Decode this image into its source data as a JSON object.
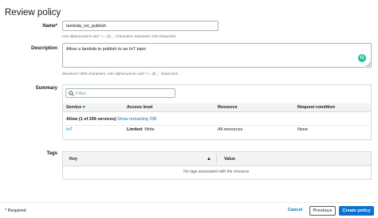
{
  "page": {
    "title": "Review policy"
  },
  "form": {
    "name": {
      "label": "Name*",
      "value": "lambda_iot_publish",
      "hint": "Use alphanumeric and '+=,.@-_' characters. Maximum 128 characters."
    },
    "description": {
      "label": "Description",
      "value": "Allow a lambda to publish to an IoT topic",
      "hint": "Maximum 1000 characters. Use alphanumeric and '+=,.@-_' characters.",
      "grammarly_icon": "G"
    }
  },
  "summary": {
    "label": "Summary",
    "filter_placeholder": "Filter",
    "columns": {
      "service": "Service",
      "access": "Access level",
      "resource": "Resource",
      "request": "Request condition"
    },
    "allow_text": "Allow (1 of 299 services)",
    "show_remaining": "Show remaining 298",
    "rows": [
      {
        "service": "IoT",
        "access_level": "Limited",
        "access_detail": ": Write",
        "resource": "All resources",
        "request": "None"
      }
    ]
  },
  "tags": {
    "label": "Tags",
    "columns": {
      "key": "Key",
      "value": "Value"
    },
    "empty_text": "No tags associated with the resource."
  },
  "footer": {
    "required_note": "* Required",
    "cancel_label": "Cancel",
    "previous_label": "Previous",
    "create_label": "Create policy"
  },
  "colors": {
    "primary": "#0972d3",
    "link": "#0073bb",
    "grammarly": "#15c39a"
  }
}
